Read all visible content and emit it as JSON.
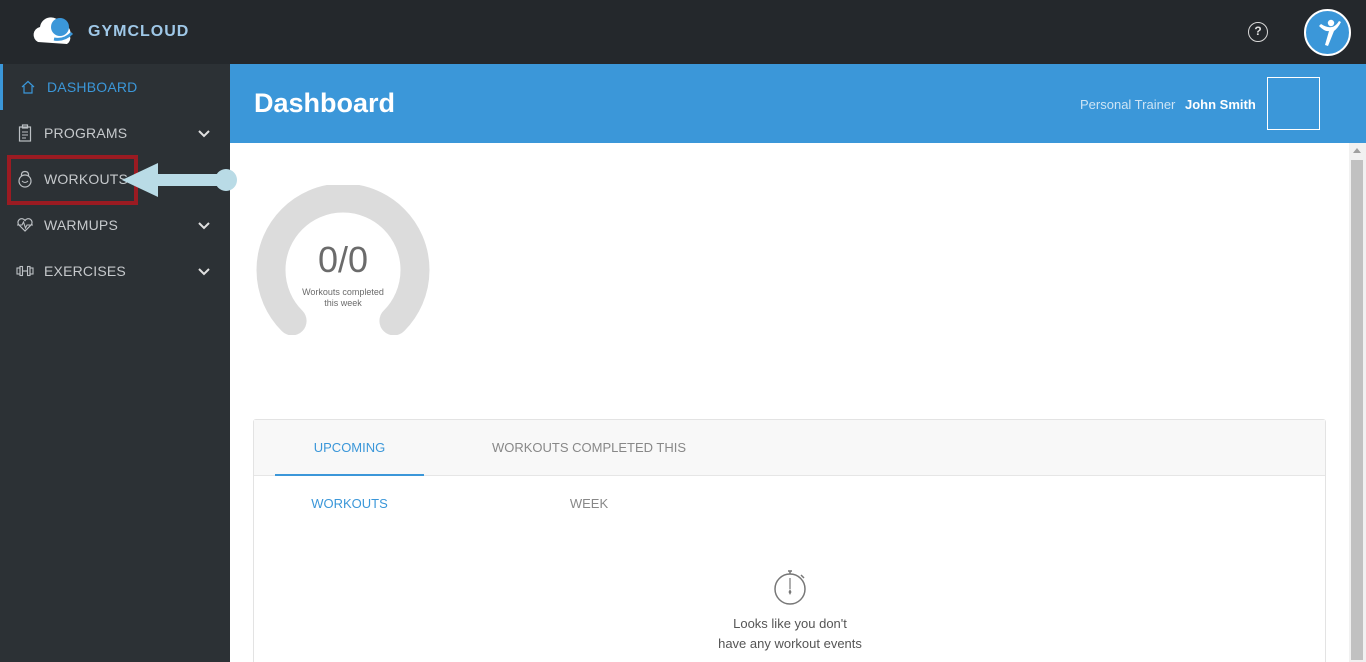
{
  "app": {
    "logo_text": "GYMCLOUD"
  },
  "topbar": {
    "help_label": "?"
  },
  "sidebar": {
    "items": [
      {
        "label": "DASHBOARD",
        "icon": "home-icon",
        "active": true
      },
      {
        "label": "PROGRAMS",
        "icon": "clipboard-icon",
        "expandable": true
      },
      {
        "label": "WORKOUTS",
        "icon": "kettlebell-icon",
        "highlighted": true
      },
      {
        "label": "WARMUPS",
        "icon": "heartbeat-icon",
        "expandable": true
      },
      {
        "label": "EXERCISES",
        "icon": "dumbbell-icon",
        "expandable": true
      }
    ]
  },
  "header": {
    "title": "Dashboard",
    "role": "Personal Trainer",
    "user_name": "John Smith"
  },
  "gauge": {
    "value_text": "0/0",
    "completed": 0,
    "total": 0,
    "caption": "Workouts completed this week"
  },
  "tabs": [
    {
      "label": "UPCOMING WORKOUTS",
      "active": true
    },
    {
      "label": "WORKOUTS COMPLETED THIS WEEK",
      "active": false
    }
  ],
  "empty_state": {
    "icon": "stopwatch-icon",
    "line1": "Looks like you don't",
    "line2": "have any workout events"
  },
  "colors": {
    "accent": "#3b97d9",
    "topbar": "#24282c",
    "sidebar": "#2c3135",
    "highlight": "#9b1b22",
    "arrow": "#b9dbe6"
  }
}
